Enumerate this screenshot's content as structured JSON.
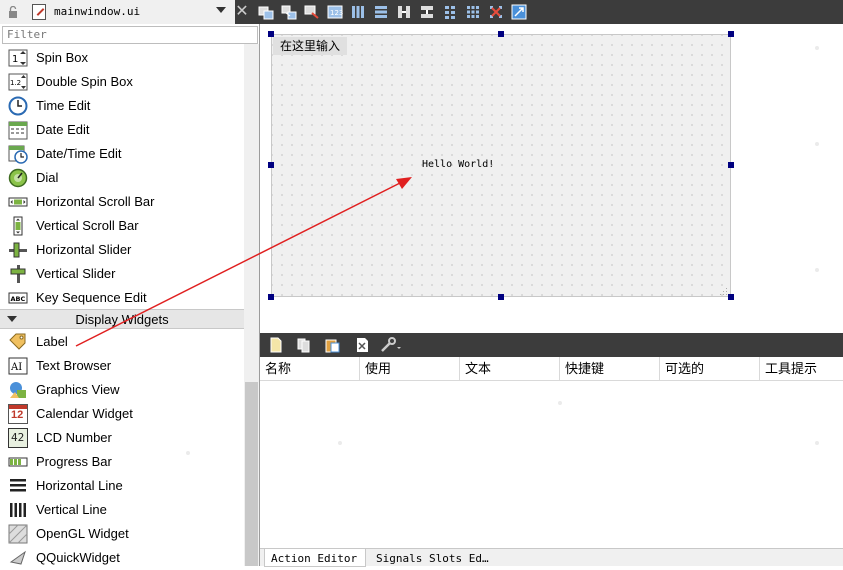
{
  "document": {
    "file_name": "mainwindow.ui"
  },
  "widget_box": {
    "filter_placeholder": "Filter",
    "input_widgets": [
      {
        "label": "Spin Box",
        "icon": "spin-box-icon"
      },
      {
        "label": "Double Spin Box",
        "icon": "double-spin-box-icon"
      },
      {
        "label": "Time Edit",
        "icon": "time-edit-icon"
      },
      {
        "label": "Date Edit",
        "icon": "date-edit-icon"
      },
      {
        "label": "Date/Time Edit",
        "icon": "date-time-edit-icon"
      },
      {
        "label": "Dial",
        "icon": "dial-icon"
      },
      {
        "label": "Horizontal Scroll Bar",
        "icon": "horizontal-scroll-bar-icon"
      },
      {
        "label": "Vertical Scroll Bar",
        "icon": "vertical-scroll-bar-icon"
      },
      {
        "label": "Horizontal Slider",
        "icon": "horizontal-slider-icon"
      },
      {
        "label": "Vertical Slider",
        "icon": "vertical-slider-icon"
      },
      {
        "label": "Key Sequence Edit",
        "icon": "key-sequence-edit-icon"
      }
    ],
    "display_category": "Display Widgets",
    "display_widgets": [
      {
        "label": "Label",
        "icon": "label-icon"
      },
      {
        "label": "Text Browser",
        "icon": "text-browser-icon"
      },
      {
        "label": "Graphics View",
        "icon": "graphics-view-icon"
      },
      {
        "label": "Calendar Widget",
        "icon": "calendar-widget-icon",
        "icon_text": "12"
      },
      {
        "label": "LCD Number",
        "icon": "lcd-number-icon",
        "icon_text": "42"
      },
      {
        "label": "Progress Bar",
        "icon": "progress-bar-icon"
      },
      {
        "label": "Horizontal Line",
        "icon": "horizontal-line-icon"
      },
      {
        "label": "Vertical Line",
        "icon": "vertical-line-icon"
      },
      {
        "label": "OpenGL Widget",
        "icon": "opengl-widget-icon"
      },
      {
        "label": "QQuickWidget",
        "icon": "qquickwidget-icon"
      }
    ]
  },
  "form": {
    "menu_placeholder": "在这里输入",
    "label_text": "Hello World!"
  },
  "action_editor": {
    "columns": [
      "名称",
      "使用",
      "文本",
      "快捷键",
      "可选的",
      "工具提示"
    ],
    "tabs": [
      "Action Editor",
      "Signals  Slots Ed…"
    ]
  },
  "colors": {
    "toolbar_dark": "#3c3c3c",
    "selection_handle": "#000080",
    "drag_arrow": "#e02020"
  }
}
